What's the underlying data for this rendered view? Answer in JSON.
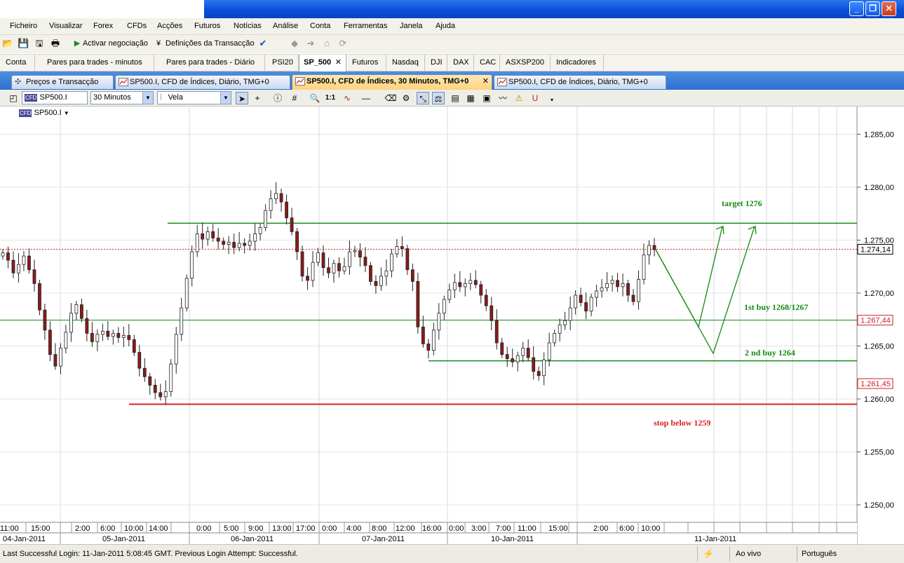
{
  "window": {
    "minimize_glyph": "_",
    "maximize_glyph": "❐",
    "close_glyph": "✕"
  },
  "menu": [
    "Ficheiro",
    "Visualizar",
    "Forex",
    "CFDs",
    "Acções",
    "Futuros",
    "Notícias",
    "Análise",
    "Conta",
    "Ferramentas",
    "Janela",
    "Ajuda"
  ],
  "toolbar": {
    "activate_trading": "Activar negociação",
    "transaction_settings": "Definições da Transacção"
  },
  "workspace_tabs": [
    "Conta",
    "Pares para trades - minutos",
    "Pares para trades - Diário",
    "PSI20",
    "SP_500",
    "Futuros",
    "Nasdaq",
    "DJI",
    "DAX",
    "CAC",
    "ASXSP200",
    "Indicadores"
  ],
  "active_workspace_tab": "SP_500",
  "chart_tabs": [
    "Preços e Transacção",
    "SP500.I, CFD de Índices, Diário, TMG+0",
    "SP500.I, CFD de Índices, 30 Minutos, TMG+0",
    "SP500.I, CFD de Índices, Diário, TMG+0"
  ],
  "chart_toolbar": {
    "instrument": "SP500.I",
    "period": "30 Minutos",
    "chart_type": "Vela",
    "ratio": "1:1"
  },
  "symbol_tag": "SP500.I",
  "status": {
    "login_message": "Last Successful Login: 11-Jan-2011 5:08:45 GMT. Previous Login Attempt: Successful.",
    "mode": "Ao vivo",
    "language": "Português"
  },
  "colors": {
    "title_bar": "#0a4fd8",
    "green_line": "#148a14",
    "red_line": "#dd2222",
    "bull_candle": "#ffffff",
    "bear_candle": "#8b1a1a"
  },
  "chart_data": {
    "type": "candlestick",
    "ylim": [
      1247.5,
      1287.5
    ],
    "y_ticks": [
      "1.285,00",
      "1.280,00",
      "1.275,00",
      "1.270,00",
      "1.265,00",
      "1.260,00",
      "1.255,00",
      "1.250,00"
    ],
    "y_tick_values": [
      1285,
      1280,
      1275,
      1270,
      1265,
      1260,
      1255,
      1250
    ],
    "price_labels": [
      {
        "text": "1.274,14",
        "value": 1274.14,
        "style": "current"
      },
      {
        "text": "1.267,44",
        "value": 1267.44,
        "style": "red"
      },
      {
        "text": "1.261,45",
        "value": 1261.45,
        "style": "red"
      }
    ],
    "time_labels": [
      "11:00",
      "15:00",
      "2:00",
      "6:00",
      "10:00",
      "14:00",
      "0:00",
      "5:00",
      "9:00",
      "13:00",
      "17:00",
      "0:00",
      "4:00",
      "8:00",
      "12:00",
      "16:00",
      "0:00",
      "3:00",
      "7:00",
      "11:00",
      "15:00",
      "2:00",
      "6:00",
      "10:00"
    ],
    "date_labels": [
      "04-Jan-2011",
      "05-Jan-2011",
      "06-Jan-2011",
      "07-Jan-2011",
      "10-Jan-2011",
      "11-Jan-2011"
    ],
    "annotations": [
      {
        "text": "target 1276",
        "color": "#148a14"
      },
      {
        "text": "1st buy 1268/1267",
        "color": "#148a14"
      },
      {
        "text": "2 nd buy 1264",
        "color": "#148a14"
      },
      {
        "text": "stop below 1259",
        "color": "#dd2222"
      }
    ],
    "levels": [
      {
        "name": "target",
        "value": 1276.6,
        "color": "#148a14"
      },
      {
        "name": "first-buy",
        "value": 1267.44,
        "color": "#148a14"
      },
      {
        "name": "second-buy",
        "value": 1263.6,
        "color": "#148a14"
      },
      {
        "name": "stop",
        "value": 1259.5,
        "color": "#dd2222"
      },
      {
        "name": "current",
        "value": 1274.14,
        "color": "#dd2222",
        "dashed": true
      }
    ],
    "closes": [
      1273.8,
      1273.1,
      1271.9,
      1272.7,
      1273.5,
      1272.2,
      1270.9,
      1268.4,
      1266.5,
      1264.2,
      1263.1,
      1264.8,
      1266.3,
      1268.1,
      1268.9,
      1267.6,
      1266.2,
      1265.4,
      1266.1,
      1266.4,
      1265.9,
      1266.2,
      1265.8,
      1266.0,
      1265.6,
      1264.4,
      1262.9,
      1262.1,
      1261.3,
      1260.6,
      1260.2,
      1260.7,
      1263.3,
      1266.1,
      1268.6,
      1271.4,
      1273.9,
      1275.6,
      1275.1,
      1275.8,
      1275.2,
      1274.9,
      1274.6,
      1274.8,
      1274.3,
      1274.7,
      1274.5,
      1274.9,
      1275.6,
      1276.2,
      1277.8,
      1278.9,
      1279.4,
      1278.6,
      1277.1,
      1275.8,
      1273.9,
      1271.6,
      1271.2,
      1272.9,
      1273.8,
      1272.4,
      1271.9,
      1272.8,
      1272.1,
      1272.5,
      1273.9,
      1274.0,
      1273.4,
      1272.6,
      1271.1,
      1270.7,
      1271.6,
      1272.1,
      1273.7,
      1274.4,
      1274.2,
      1272.2,
      1271.1,
      1266.8,
      1265.2,
      1264.6,
      1266.5,
      1268.1,
      1269.4,
      1270.3,
      1271.0,
      1270.6,
      1270.9,
      1271.2,
      1270.8,
      1269.8,
      1268.8,
      1267.4,
      1265.3,
      1264.2,
      1263.8,
      1263.5,
      1264.1,
      1264.8,
      1263.9,
      1262.6,
      1262.2,
      1263.7,
      1265.3,
      1266.2,
      1267.0,
      1267.4,
      1268.6,
      1269.8,
      1269.1,
      1268.3,
      1269.6,
      1270.2,
      1270.5,
      1270.9,
      1271.2,
      1270.6,
      1270.9,
      1269.8,
      1269.2,
      1271.3,
      1273.6,
      1274.5,
      1274.1
    ]
  }
}
